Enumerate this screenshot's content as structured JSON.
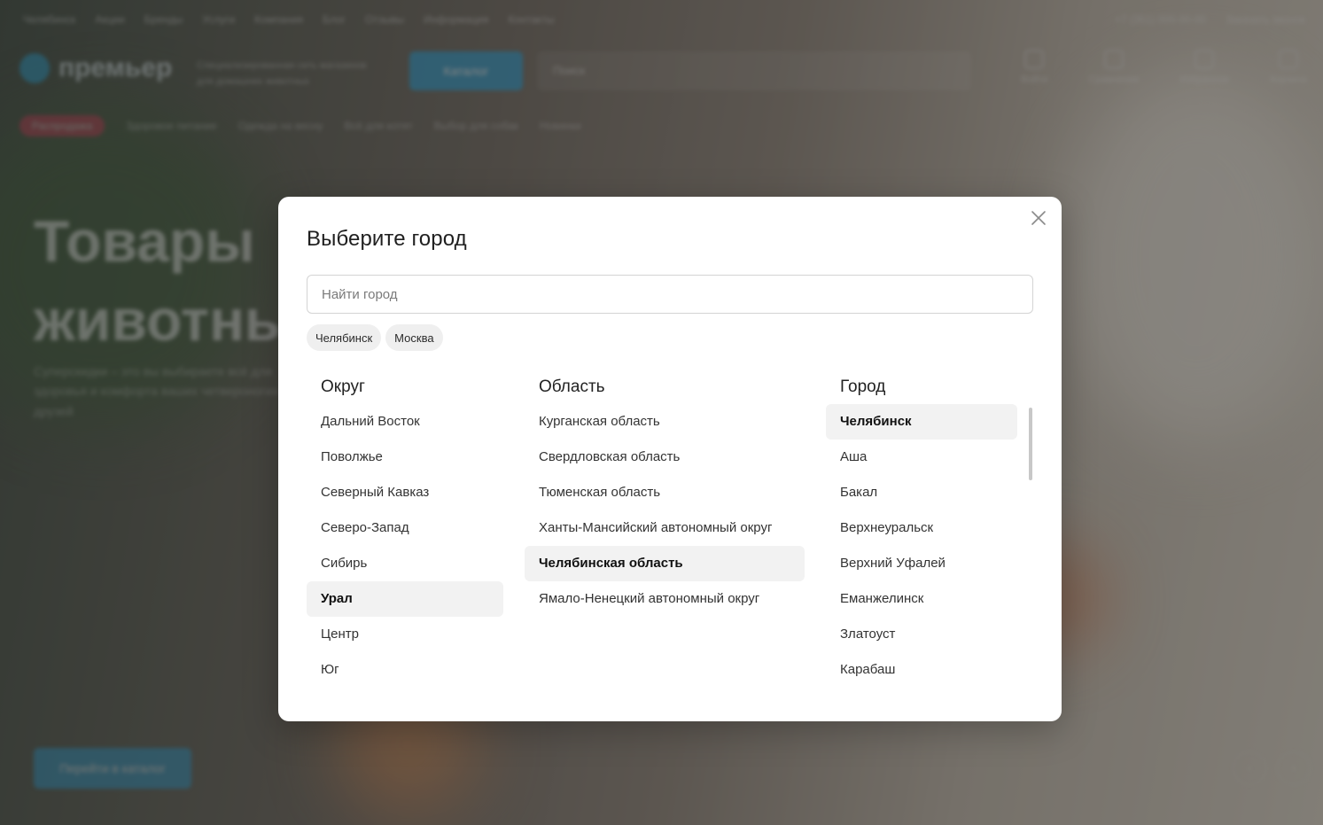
{
  "background": {
    "topbar": {
      "location": "Челябинск",
      "links": [
        "Акции",
        "Бренды",
        "Услуги",
        "Компания",
        "Блог",
        "Отзывы",
        "Информация",
        "Контакты"
      ],
      "phone": "+7 (351) 000-00-00",
      "callback": "Заказать звонок"
    },
    "logo_text": "премьер",
    "logo_sub": "Специализированная сеть магазинов для домашних животных",
    "catalog_label": "Каталог",
    "search_placeholder": "Поиск",
    "header_icons": [
      {
        "icon": "user-icon",
        "label": "Войти"
      },
      {
        "icon": "compare-icon",
        "label": "Сравнение"
      },
      {
        "icon": "heart-icon",
        "label": "Избранное"
      },
      {
        "icon": "cart-icon",
        "label": "Корзина"
      }
    ],
    "promo_badge": "Распродажа",
    "promo_links": [
      "Здоровое питание",
      "Одежда на весну",
      "Всё для котят",
      "Выбор для собак",
      "Новинки"
    ],
    "hero_title_line1": "Товары",
    "hero_title_line2": "животны",
    "hero_text": "Суперскидки – это вы выбираете всё для здоровья и комфорта ваших четвероногих друзей",
    "hero_button": "Перейти в каталог"
  },
  "modal": {
    "title": "Выберите город",
    "search_placeholder": "Найти город",
    "search_value": "",
    "quick_cities": [
      "Челябинск",
      "Москва"
    ],
    "columns": {
      "district": {
        "header": "Округ",
        "items": [
          "Дальний Восток",
          "Поволжье",
          "Северный Кавказ",
          "Северо-Запад",
          "Сибирь",
          "Урал",
          "Центр",
          "Юг"
        ],
        "selected": "Урал"
      },
      "region": {
        "header": "Область",
        "items": [
          "Курганская область",
          "Свердловская область",
          "Тюменская область",
          "Ханты-Мансийский автономный округ",
          "Челябинская область",
          "Ямало-Ненецкий автономный округ"
        ],
        "selected": "Челябинская область"
      },
      "city": {
        "header": "Город",
        "items": [
          "Челябинск",
          "Аша",
          "Бакал",
          "Верхнеуральск",
          "Верхний Уфалей",
          "Еманжелинск",
          "Златоуст",
          "Карабаш"
        ],
        "selected": "Челябинск"
      }
    }
  },
  "colors": {
    "accent": "#2f9fd0",
    "promo": "#e03a5a",
    "selected_bg": "#f2f2f2"
  }
}
